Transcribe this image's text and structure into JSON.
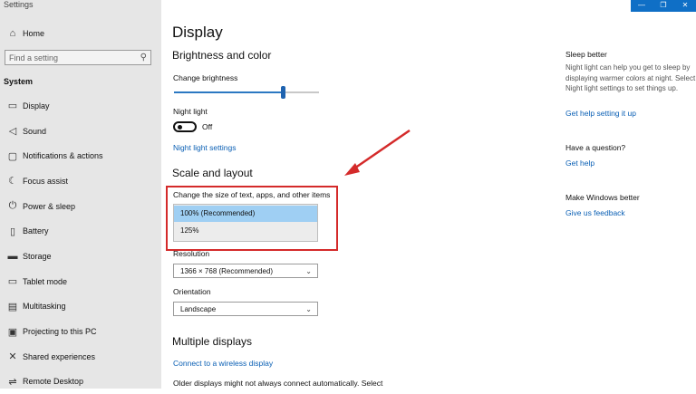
{
  "window": {
    "title": "Settings"
  },
  "sidebar": {
    "home_label": "Home",
    "search_placeholder": "Find a setting",
    "section": "System",
    "items": [
      {
        "label": "Display",
        "icon": "monitor-icon"
      },
      {
        "label": "Sound",
        "icon": "speaker-icon"
      },
      {
        "label": "Notifications & actions",
        "icon": "notification-icon"
      },
      {
        "label": "Focus assist",
        "icon": "moon-icon"
      },
      {
        "label": "Power & sleep",
        "icon": "power-icon"
      },
      {
        "label": "Battery",
        "icon": "battery-icon"
      },
      {
        "label": "Storage",
        "icon": "storage-icon"
      },
      {
        "label": "Tablet mode",
        "icon": "tablet-icon"
      },
      {
        "label": "Multitasking",
        "icon": "multitask-icon"
      },
      {
        "label": "Projecting to this PC",
        "icon": "project-icon"
      },
      {
        "label": "Shared experiences",
        "icon": "shared-icon"
      },
      {
        "label": "Remote Desktop",
        "icon": "remote-icon"
      }
    ]
  },
  "titlebar": {
    "minimize": "—",
    "maximize": "❐",
    "close": "✕"
  },
  "main": {
    "title": "Display",
    "brightness_heading": "Brightness and color",
    "brightness_label": "Change brightness",
    "brightness_value": 0.75,
    "night_light_label": "Night light",
    "night_light_state": "Off",
    "night_light_link": "Night light settings",
    "scale_heading": "Scale and layout",
    "scale_label": "Change the size of text, apps, and other items",
    "scale_options": [
      "100% (Recommended)",
      "125%"
    ],
    "resolution_label": "Resolution",
    "resolution_value": "1366 × 768 (Recommended)",
    "orientation_label": "Orientation",
    "orientation_value": "Landscape",
    "multi_heading": "Multiple displays",
    "wireless_link": "Connect to a wireless display",
    "older_text": "Older displays might not always connect automatically. Select"
  },
  "right": {
    "sleep_heading": "Sleep better",
    "sleep_text": "Night light can help you get to sleep by displaying warmer colors at night. Select Night light settings to set things up.",
    "sleep_link": "Get help setting it up",
    "question_heading": "Have a question?",
    "question_link": "Get help",
    "better_heading": "Make Windows better",
    "better_link": "Give us feedback"
  },
  "colors": {
    "accent": "#0f6fc6",
    "highlight": "#d42a2a",
    "selected_option": "#9fcff3"
  }
}
